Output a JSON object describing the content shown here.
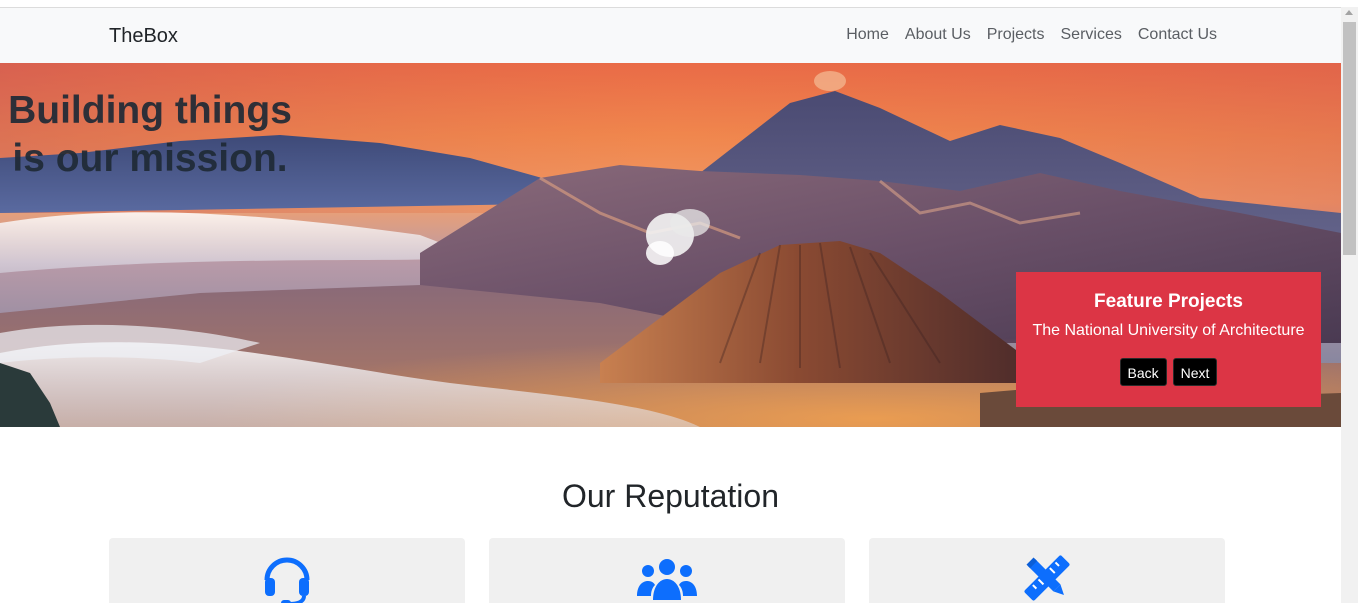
{
  "brand": "TheBox",
  "nav": {
    "items": [
      {
        "label": "Home"
      },
      {
        "label": "About Us"
      },
      {
        "label": "Projects"
      },
      {
        "label": "Services"
      },
      {
        "label": "Contact Us"
      }
    ]
  },
  "hero": {
    "heading_line1": "Building things",
    "heading_line2": "is our mission.",
    "image": "volcano-landscape-photo"
  },
  "feature": {
    "title": "Feature Projects",
    "subtitle": "The National University of Architecture",
    "back_label": "Back",
    "next_label": "Next",
    "background_color": "#dc3545"
  },
  "reputation": {
    "title": "Our Reputation",
    "cards": [
      {
        "icon": "headset-icon"
      },
      {
        "icon": "users-icon"
      },
      {
        "icon": "pencil-ruler-icon"
      }
    ],
    "icon_color": "#0d6efd"
  },
  "colors": {
    "navbar_bg": "#f8f9fa",
    "card_bg": "#f0f0f0"
  }
}
